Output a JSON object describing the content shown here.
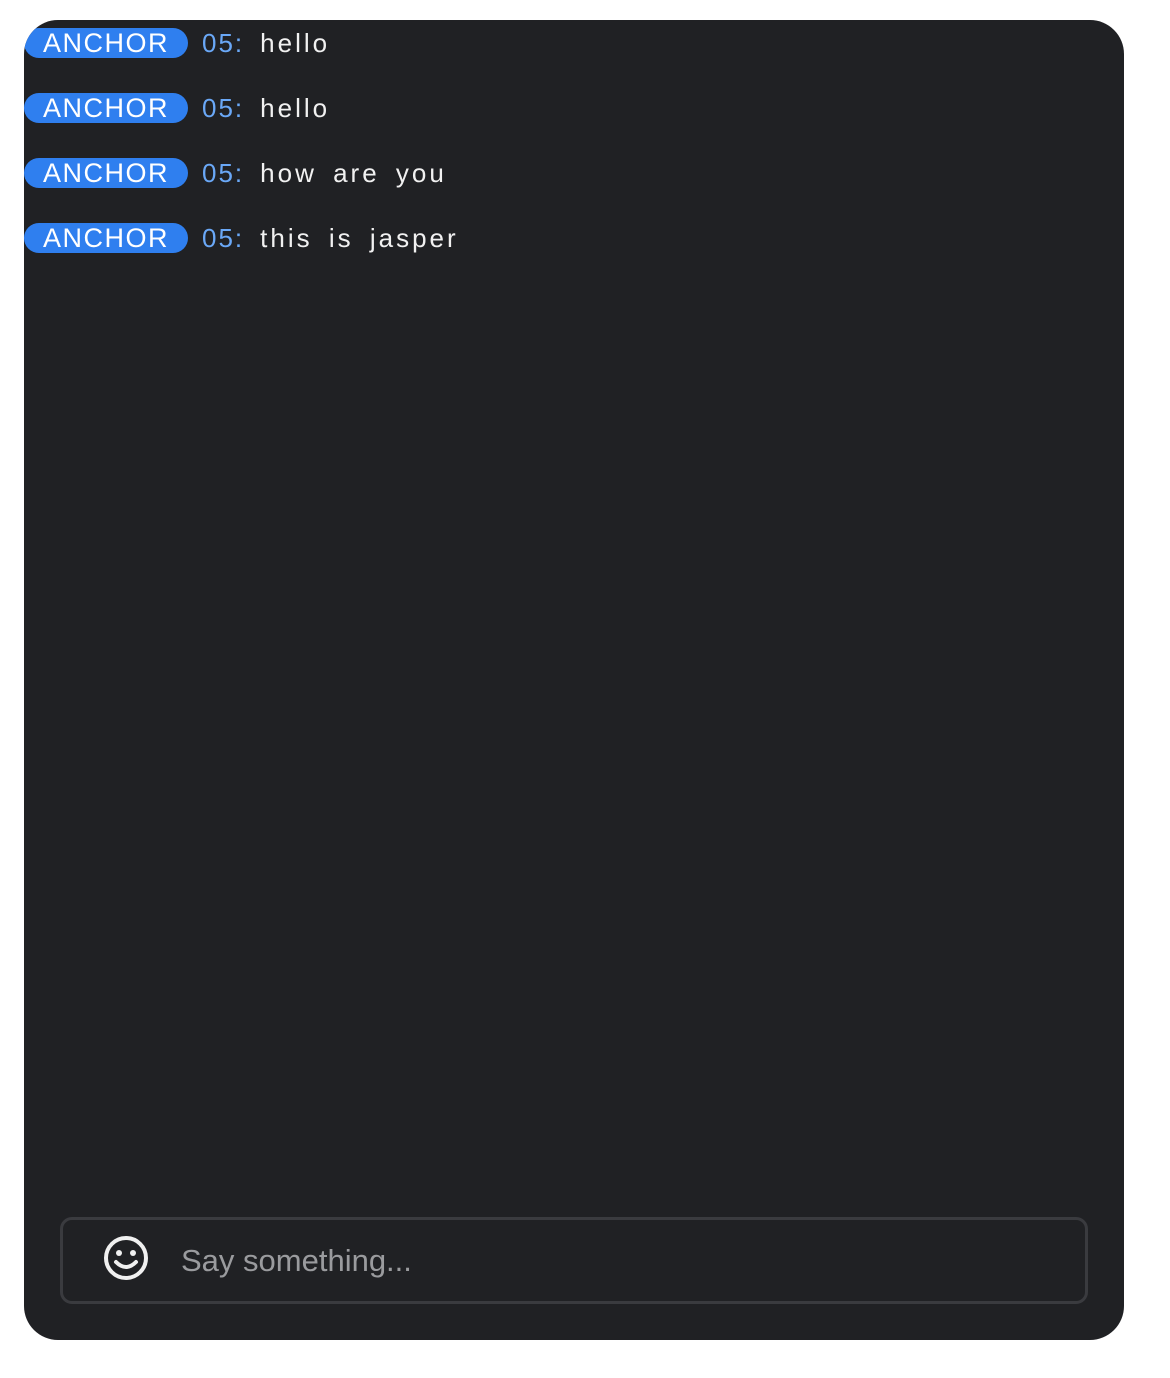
{
  "chat": {
    "messages": [
      {
        "badge": "ANCHOR",
        "sender": "05:",
        "text": "hello"
      },
      {
        "badge": "ANCHOR",
        "sender": "05:",
        "text": "hello"
      },
      {
        "badge": "ANCHOR",
        "sender": "05:",
        "text": "how are you"
      },
      {
        "badge": "ANCHOR",
        "sender": "05:",
        "text": "this is jasper"
      }
    ]
  },
  "input": {
    "placeholder": "Say something...",
    "value": "",
    "emoji_icon": "smiley-face-icon"
  },
  "colors": {
    "panel_background": "#202124",
    "badge_background": "#2f7fef",
    "sender_color": "#6aa8f7",
    "text_color": "#f1f1f1"
  }
}
